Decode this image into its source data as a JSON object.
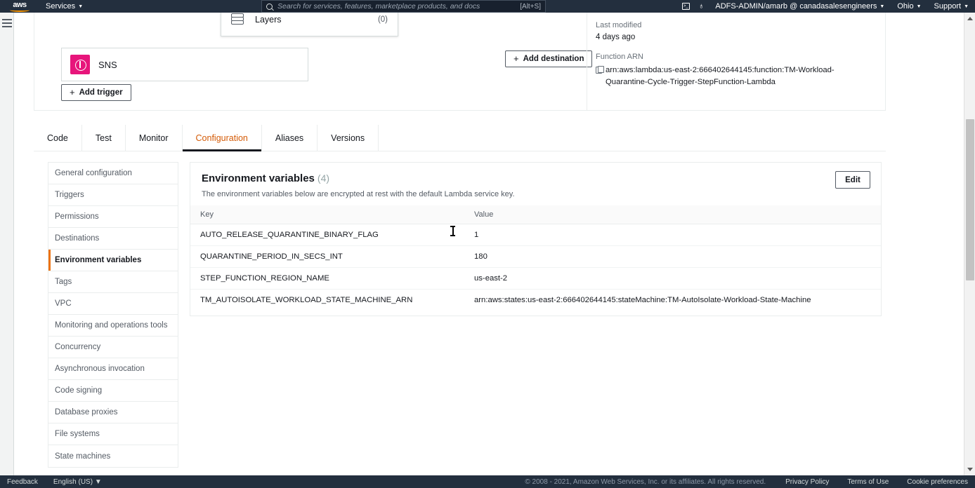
{
  "topnav": {
    "logo_text": "aws",
    "services_label": "Services",
    "caret": "▼",
    "search_placeholder": "Search for services, features, marketplace products, and docs",
    "search_shortcut": "[Alt+S]",
    "cloudshell_icon": "cloudshell-icon",
    "cloudshell_glyph": ">_",
    "bell_icon": "notifications-bell-icon",
    "bell_glyph": "♁",
    "account_label": "ADFS-ADMIN/amarb @ canadasalesengineers",
    "region_label": "Ohio",
    "support_label": "Support"
  },
  "left_rail": {
    "menu_icon": "hamburger-menu-icon"
  },
  "overview": {
    "trigger_card": {
      "service": "SNS",
      "icon": "sns-service-icon"
    },
    "add_trigger_label": "Add trigger",
    "add_destination_label": "Add destination",
    "layers_popover": {
      "label": "Layers",
      "count": "(0)",
      "icon": "layers-stack-icon"
    },
    "last_modified_label": "Last modified",
    "last_modified_value": "4 days ago",
    "function_arn_label": "Function ARN",
    "function_arn_value": "arn:aws:lambda:us-east-2:666402644145:function:TM-Workload-Quarantine-Cycle-Trigger-StepFunction-Lambda",
    "copy_icon": "copy-icon"
  },
  "tabs": [
    {
      "label": "Code",
      "active": false
    },
    {
      "label": "Test",
      "active": false
    },
    {
      "label": "Monitor",
      "active": false
    },
    {
      "label": "Configuration",
      "active": true
    },
    {
      "label": "Aliases",
      "active": false
    },
    {
      "label": "Versions",
      "active": false
    }
  ],
  "sidebar": {
    "items": [
      {
        "label": "General configuration",
        "active": false
      },
      {
        "label": "Triggers",
        "active": false
      },
      {
        "label": "Permissions",
        "active": false
      },
      {
        "label": "Destinations",
        "active": false
      },
      {
        "label": "Environment variables",
        "active": true
      },
      {
        "label": "Tags",
        "active": false
      },
      {
        "label": "VPC",
        "active": false
      },
      {
        "label": "Monitoring and operations tools",
        "active": false
      },
      {
        "label": "Concurrency",
        "active": false
      },
      {
        "label": "Asynchronous invocation",
        "active": false
      },
      {
        "label": "Code signing",
        "active": false
      },
      {
        "label": "Database proxies",
        "active": false
      },
      {
        "label": "File systems",
        "active": false
      },
      {
        "label": "State machines",
        "active": false
      }
    ]
  },
  "panel": {
    "title": "Environment variables",
    "count": "(4)",
    "description": "The environment variables below are encrypted at rest with the default Lambda service key.",
    "edit_label": "Edit",
    "columns": [
      "Key",
      "Value"
    ],
    "rows": [
      {
        "key": "AUTO_RELEASE_QUARANTINE_BINARY_FLAG",
        "value": "1"
      },
      {
        "key": "QUARANTINE_PERIOD_IN_SECS_INT",
        "value": "180"
      },
      {
        "key": "STEP_FUNCTION_REGION_NAME",
        "value": "us-east-2"
      },
      {
        "key": "TM_AUTOISOLATE_WORKLOAD_STATE_MACHINE_ARN",
        "value": "arn:aws:states:us-east-2:666402644145:stateMachine:TM-AutoIsolate-Workload-State-Machine"
      }
    ]
  },
  "footer": {
    "feedback_label": "Feedback",
    "language_label": "English (US)",
    "language_caret": "▼",
    "copyright": "© 2008 - 2021, Amazon Web Services, Inc. or its affiliates. All rights reserved.",
    "privacy_label": "Privacy Policy",
    "terms_label": "Terms of Use",
    "cookie_label": "Cookie preferences"
  },
  "colors": {
    "nav_bg": "#232f3e",
    "accent_orange": "#ec7211",
    "tab_active": "#d45b07",
    "sns_pink": "#e7157b"
  }
}
